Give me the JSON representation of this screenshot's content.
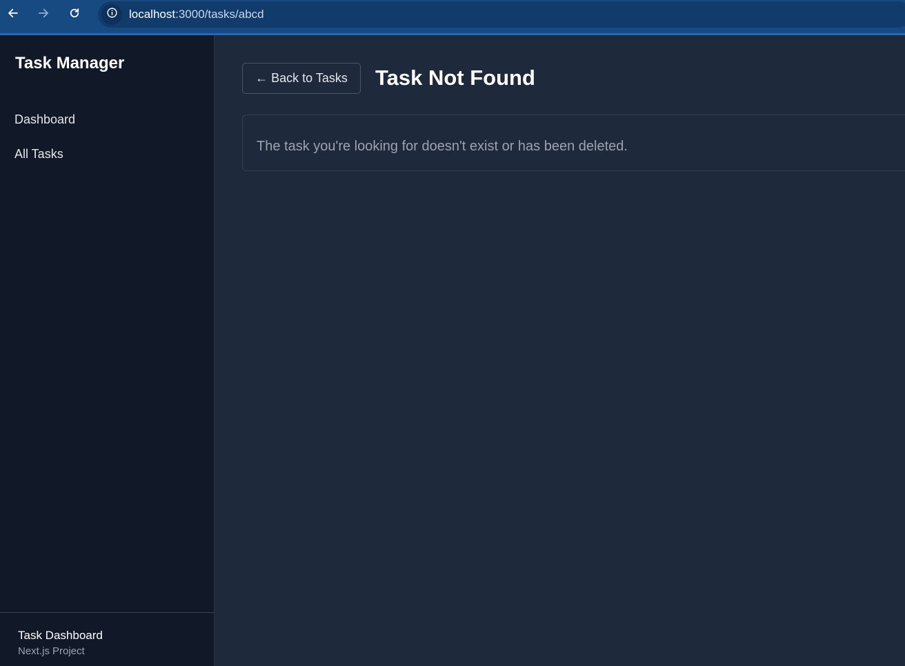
{
  "browser": {
    "url_host": "localhost",
    "url_path": ":3000/tasks/abcd",
    "icons": {
      "back": "arrow-left-icon",
      "forward": "arrow-right-icon",
      "reload": "reload-icon",
      "site_info": "info-icon"
    }
  },
  "sidebar": {
    "brand": "Task Manager",
    "items": [
      {
        "label": "Dashboard"
      },
      {
        "label": "All Tasks"
      }
    ],
    "footer": {
      "title": "Task Dashboard",
      "subtitle": "Next.js Project"
    }
  },
  "main": {
    "back_button": "← Back to Tasks",
    "title": "Task Not Found",
    "message": "The task you're looking for doesn't exist or has been deleted."
  },
  "colors": {
    "browser_bar": "#174a80",
    "sidebar_bg": "#111827",
    "main_bg": "#1e293b",
    "text_primary": "#ffffff",
    "text_muted": "#9ca3af"
  }
}
